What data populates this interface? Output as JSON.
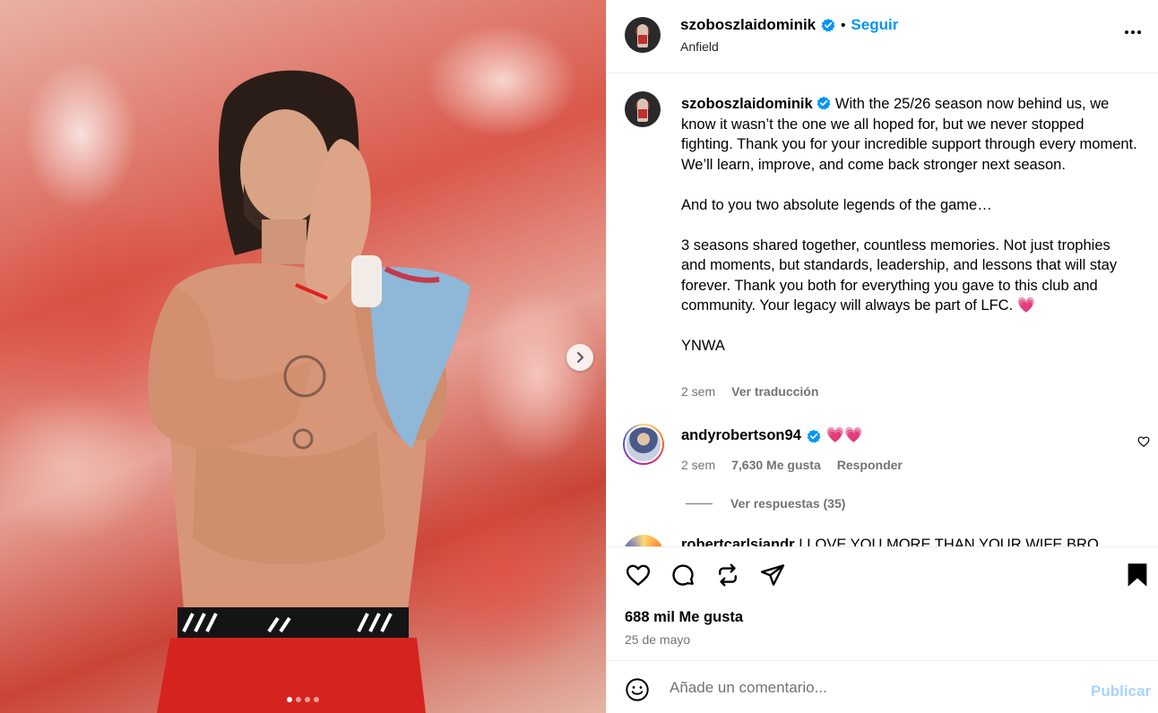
{
  "post": {
    "username": "szoboszlaidominik",
    "follow_label": "Seguir",
    "separator": "•",
    "location": "Anfield",
    "more_icon": "more-horizontal-icon"
  },
  "caption": {
    "username": "szoboszlaidominik",
    "paragraph_1": "With the 25/26 season now behind us, we know it wasn’t the one we all hoped for, but we never stopped fighting. Thank you for your incredible support through every moment. We’ll learn, improve, and come back stronger next season.",
    "paragraph_2": "And to you two absolute legends of the game…",
    "paragraph_3": "3 seasons shared together, countless memories. Not just trophies and moments, but standards, leadership, and lessons that will stay forever. Thank you both for everything you gave to this club and community. Your legacy will always be part of LFC.",
    "paragraph_3_emoji": "💗",
    "paragraph_4": "YNWA",
    "time": "2 sem",
    "translate_label": "Ver traducción"
  },
  "comments": [
    {
      "username": "andyrobertson94",
      "text": "💗💗",
      "time": "2 sem",
      "likes": "7,630 Me gusta",
      "reply_label": "Responder",
      "view_replies": "Ver respuestas (35)"
    },
    {
      "username": "robertcarlsiandr",
      "text": "I LOVE YOU MORE THAN YOUR WIFE BRO"
    }
  ],
  "stats": {
    "likes": "688 mil Me gusta",
    "date": "25 de mayo"
  },
  "composer": {
    "placeholder": "Añade un comentario...",
    "publish_label": "Publicar"
  },
  "carousel": {
    "slide_count": 4,
    "active_slide": 1
  },
  "colors": {
    "accent": "#0095f6",
    "publish_disabled": "#a8d4fb",
    "verified": "#0095f6",
    "muted": "#737373"
  }
}
